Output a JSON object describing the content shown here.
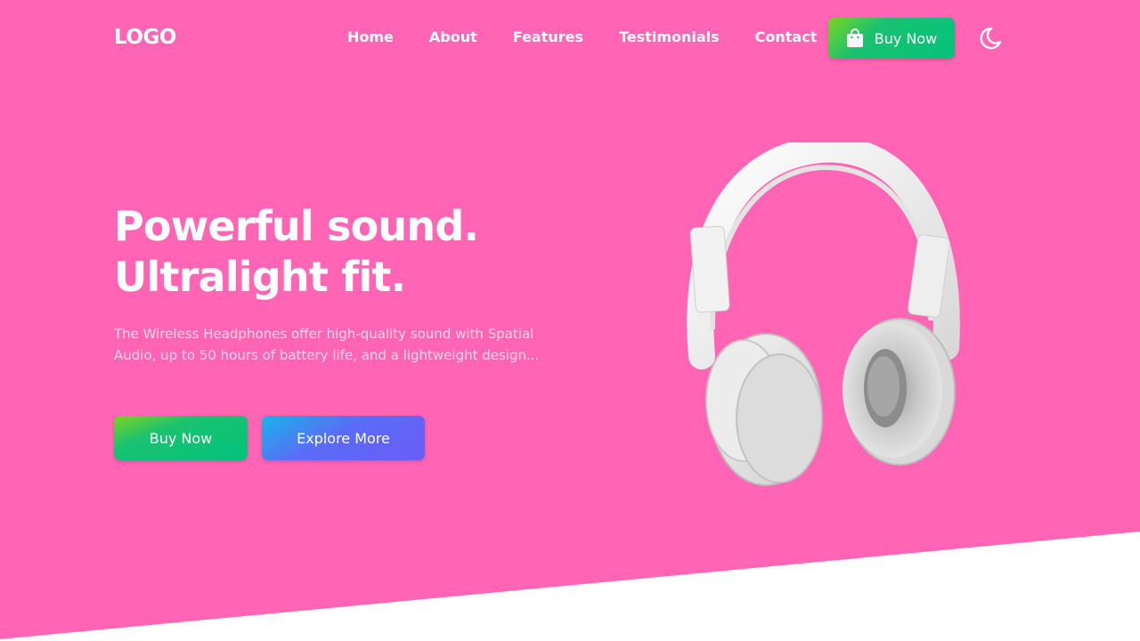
{
  "header": {
    "logo": "LOGO",
    "nav": [
      "Home",
      "About",
      "Features",
      "Testimonials",
      "Contact"
    ],
    "buy_label": "Buy Now",
    "buy_icon": "shopping-bag-icon",
    "theme_icon": "moon-icon"
  },
  "hero": {
    "headline_line1": "Powerful sound.",
    "headline_line2": "Ultralight fit.",
    "description": "The Wireless Headphones offer high-quality sound with Spatial Audio, up to 50 hours of battery life, and a lightweight design...",
    "primary_button": "Buy Now",
    "secondary_button": "Explore More"
  },
  "colors": {
    "hero_background": "#ff64b5",
    "buy_gradient": [
      "#7ed321",
      "#04c27d"
    ],
    "explore_gradient": [
      "#18b4e8",
      "#6a5cf8"
    ]
  }
}
